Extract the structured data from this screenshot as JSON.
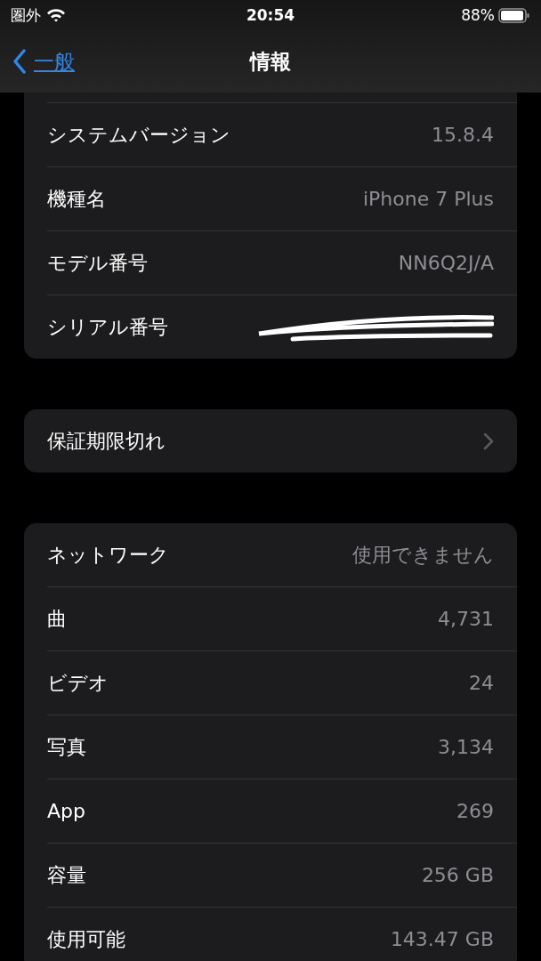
{
  "status_bar": {
    "carrier": "圏外",
    "time": "20:54",
    "battery": "88%"
  },
  "nav": {
    "back": "一般",
    "title": "情報"
  },
  "groups": [
    {
      "clipped_top": true,
      "rows": [
        {
          "kind": "value",
          "label": "システムバージョン",
          "value": "15.8.4"
        },
        {
          "kind": "value",
          "label": "機種名",
          "value": "iPhone 7 Plus"
        },
        {
          "kind": "value",
          "label": "モデル番号",
          "value": "NN6Q2J/A"
        },
        {
          "kind": "redacted",
          "label": "シリアル番号"
        }
      ]
    },
    {
      "clipped_top": false,
      "rows": [
        {
          "kind": "link",
          "label": "保証期限切れ"
        }
      ]
    },
    {
      "clipped_top": false,
      "rows": [
        {
          "kind": "value",
          "label": "ネットワーク",
          "value": "使用できません"
        },
        {
          "kind": "value",
          "label": "曲",
          "value": "4,731"
        },
        {
          "kind": "value",
          "label": "ビデオ",
          "value": "24"
        },
        {
          "kind": "value",
          "label": "写真",
          "value": "3,134"
        },
        {
          "kind": "value",
          "label": "App",
          "value": "269"
        },
        {
          "kind": "value",
          "label": "容量",
          "value": "256 GB"
        },
        {
          "kind": "value",
          "label": "使用可能",
          "value": "143.47 GB"
        }
      ]
    }
  ]
}
